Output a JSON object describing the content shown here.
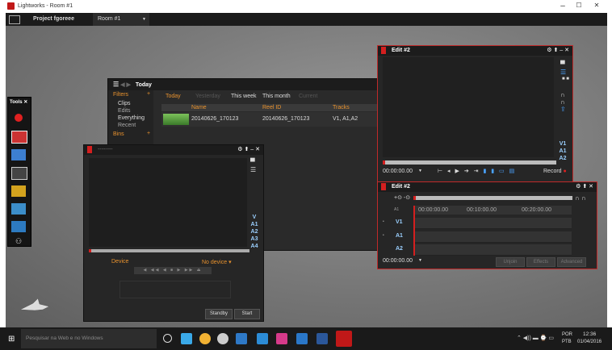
{
  "window": {
    "title": "Lightworks - Room #1",
    "minimize": "–",
    "maximize": "☐",
    "close": "✕"
  },
  "project_bar": {
    "project": "Project fgoreee",
    "room": "Room #1"
  },
  "clips_panel": {
    "title": "Today",
    "sidebar": {
      "filters": "Filters",
      "items": [
        "Clips",
        "Edits",
        "Everything",
        "Recent"
      ],
      "bins": "Bins"
    },
    "tabs": [
      "Today",
      "Yesterday",
      "This week",
      "This month",
      "Current"
    ],
    "columns": [
      "Name",
      "Reel ID",
      "Tracks"
    ],
    "rows": [
      {
        "name": "20140626_170123",
        "reel": "20140626_170123",
        "tracks": "V1, A1,A2"
      }
    ]
  },
  "viewer": {
    "title": "--------",
    "tracks": [
      "V",
      "A1",
      "A2",
      "A3",
      "A4"
    ],
    "device_label": "Device",
    "device_value": "No device",
    "standby": "Standby",
    "start": "Start"
  },
  "edit_viewer": {
    "title": "Edit #2",
    "tracks": [
      "V1",
      "A1",
      "A2"
    ],
    "timecode": "00:00:00.00",
    "record": "Record"
  },
  "timeline": {
    "title": "Edit #2",
    "marks": [
      "00:00:00.00",
      "00:10:00.00",
      "00:20:00.00"
    ],
    "track_row_label": "A1",
    "tracks": [
      "V1",
      "A1",
      "A2"
    ],
    "timecode": "00:00:00.00",
    "buttons": [
      "Unjoin",
      "Effects",
      "Advanced"
    ]
  },
  "taskbar": {
    "search_placeholder": "Pesquisar na Web e no Windows",
    "lang1": "POR",
    "lang2": "PTB",
    "time": "12:36",
    "date": "01/04/2016"
  },
  "colors": {
    "accent_red": "#c02a2a",
    "track_blue": "#9bd0ff",
    "orange": "#e8922e"
  }
}
